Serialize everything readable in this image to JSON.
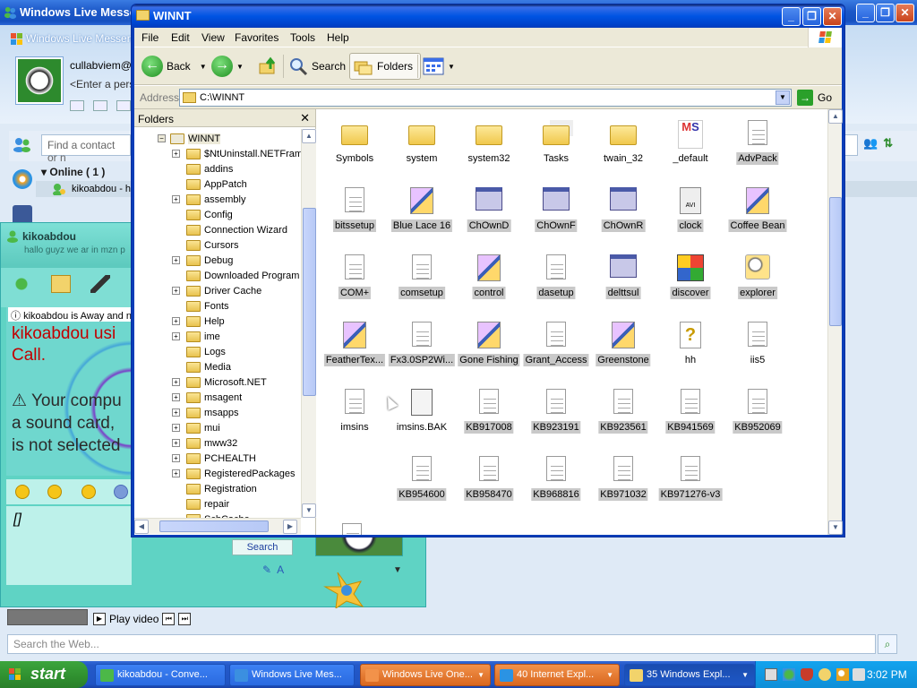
{
  "messenger": {
    "window_title": "Windows Live Messenger",
    "app_name": "Windows Live Messenger",
    "user_name": "cullabviem@",
    "personal_message": "<Enter a perso",
    "find_placeholder": "Find a contact or n",
    "group_label": "Online ( 1 )",
    "contact_name": "kikoabdou - ha",
    "play_video": "Play video",
    "web_search_placeholder": "Search the Web..."
  },
  "conversation": {
    "contact": "kikoabdou",
    "status_msg": "hallo guyz we ar in mzn p",
    "away_line": "kikoabdou is Away and n",
    "call_text_1": "kikoabdou usi",
    "call_text_2": "Call.",
    "sound_text_1": "Your compu",
    "sound_text_2": "a sound card,",
    "sound_text_3": "is not selected",
    "input_text": "[]",
    "search_label": "Search"
  },
  "explorer": {
    "title": "WINNT",
    "menu": [
      "File",
      "Edit",
      "View",
      "Favorites",
      "Tools",
      "Help"
    ],
    "toolbar": {
      "back": "Back",
      "search": "Search",
      "folders": "Folders"
    },
    "address_label": "Address",
    "address_value": "C:\\WINNT",
    "go_label": "Go",
    "folders_header": "Folders",
    "tree": [
      {
        "label": "WINNT",
        "expander": "−",
        "level": 0
      },
      {
        "label": "$NtUninstall.NETFram",
        "expander": "+",
        "level": 1
      },
      {
        "label": "addins",
        "expander": "",
        "level": 1
      },
      {
        "label": "AppPatch",
        "expander": "",
        "level": 1
      },
      {
        "label": "assembly",
        "expander": "+",
        "level": 1
      },
      {
        "label": "Config",
        "expander": "",
        "level": 1
      },
      {
        "label": "Connection Wizard",
        "expander": "",
        "level": 1
      },
      {
        "label": "Cursors",
        "expander": "",
        "level": 1
      },
      {
        "label": "Debug",
        "expander": "+",
        "level": 1
      },
      {
        "label": "Downloaded Program",
        "expander": "",
        "level": 1
      },
      {
        "label": "Driver Cache",
        "expander": "+",
        "level": 1
      },
      {
        "label": "Fonts",
        "expander": "",
        "level": 1
      },
      {
        "label": "Help",
        "expander": "+",
        "level": 1
      },
      {
        "label": "ime",
        "expander": "+",
        "level": 1
      },
      {
        "label": "Logs",
        "expander": "",
        "level": 1
      },
      {
        "label": "Media",
        "expander": "",
        "level": 1
      },
      {
        "label": "Microsoft.NET",
        "expander": "+",
        "level": 1
      },
      {
        "label": "msagent",
        "expander": "+",
        "level": 1
      },
      {
        "label": "msapps",
        "expander": "+",
        "level": 1
      },
      {
        "label": "mui",
        "expander": "+",
        "level": 1
      },
      {
        "label": "mww32",
        "expander": "+",
        "level": 1
      },
      {
        "label": "PCHEALTH",
        "expander": "+",
        "level": 1
      },
      {
        "label": "RegisteredPackages",
        "expander": "+",
        "level": 1
      },
      {
        "label": "Registration",
        "expander": "",
        "level": 1
      },
      {
        "label": "repair",
        "expander": "",
        "level": 1
      },
      {
        "label": "SchCache",
        "expander": "",
        "level": 1
      }
    ],
    "items": [
      {
        "label": "Symbols",
        "icon": "folder-icon",
        "kind": "folder",
        "selected": false
      },
      {
        "label": "system",
        "icon": "folder-icon",
        "kind": "folder",
        "selected": false
      },
      {
        "label": "system32",
        "icon": "folder-icon",
        "kind": "folder",
        "selected": false
      },
      {
        "label": "Tasks",
        "icon": "tasks-folder-icon",
        "kind": "tasks",
        "selected": false
      },
      {
        "label": "twain_32",
        "icon": "folder-icon",
        "kind": "folder",
        "selected": false
      },
      {
        "label": "_default",
        "icon": "ms-doc-icon",
        "kind": "ms",
        "selected": false
      },
      {
        "label": "AdvPack",
        "icon": "dll-icon",
        "kind": "doc",
        "selected": true
      },
      {
        "label": "bitssetup",
        "icon": "dll-icon",
        "kind": "doc",
        "selected": true
      },
      {
        "label": "Blue Lace 16",
        "icon": "bitmap-icon",
        "kind": "brush",
        "selected": true
      },
      {
        "label": "ChOwnD",
        "icon": "application-icon",
        "kind": "app",
        "selected": true
      },
      {
        "label": "ChOwnF",
        "icon": "application-icon",
        "kind": "app",
        "selected": true
      },
      {
        "label": "ChOwnR",
        "icon": "application-icon",
        "kind": "app",
        "selected": true
      },
      {
        "label": "clock",
        "icon": "avi-icon",
        "kind": "avi",
        "selected": true
      },
      {
        "label": "Coffee Bean",
        "icon": "bitmap-icon",
        "kind": "brush",
        "selected": true
      },
      {
        "label": "COM+",
        "icon": "dll-icon",
        "kind": "doc",
        "selected": true
      },
      {
        "label": "comsetup",
        "icon": "dll-icon",
        "kind": "doc",
        "selected": true
      },
      {
        "label": "control",
        "icon": "control-panel-icon",
        "kind": "brush",
        "selected": true
      },
      {
        "label": "dasetup",
        "icon": "dll-icon",
        "kind": "doc",
        "selected": true
      },
      {
        "label": "delttsul",
        "icon": "application-icon",
        "kind": "app",
        "selected": true
      },
      {
        "label": "discover",
        "icon": "discover-icon",
        "kind": "discover",
        "selected": true
      },
      {
        "label": "explorer",
        "icon": "explorer-icon",
        "kind": "search",
        "selected": true
      },
      {
        "label": "FeatherTex...",
        "icon": "bitmap-icon",
        "kind": "brush",
        "selected": true
      },
      {
        "label": "Fx3.0SP2Wi...",
        "icon": "dll-icon",
        "kind": "doc",
        "selected": true
      },
      {
        "label": "Gone Fishing",
        "icon": "bitmap-icon",
        "kind": "brush",
        "selected": true
      },
      {
        "label": "Grant_Access",
        "icon": "dll-icon",
        "kind": "doc",
        "selected": true
      },
      {
        "label": "Greenstone",
        "icon": "bitmap-icon",
        "kind": "brush",
        "selected": true
      },
      {
        "label": "hh",
        "icon": "help-icon",
        "kind": "help",
        "selected": false
      },
      {
        "label": "iis5",
        "icon": "dll-icon",
        "kind": "doc",
        "selected": false
      },
      {
        "label": "imsins",
        "icon": "dll-icon",
        "kind": "doc",
        "selected": false
      },
      {
        "label": "imsins.BAK",
        "icon": "bak-file-icon",
        "kind": "bak",
        "selected": false
      },
      {
        "label": "KB917008",
        "icon": "dll-icon",
        "kind": "doc",
        "selected": true
      },
      {
        "label": "KB923191",
        "icon": "dll-icon",
        "kind": "doc",
        "selected": true
      },
      {
        "label": "KB923561",
        "icon": "dll-icon",
        "kind": "doc",
        "selected": true
      },
      {
        "label": "KB941569",
        "icon": "dll-icon",
        "kind": "doc",
        "selected": true
      },
      {
        "label": "KB952069",
        "icon": "dll-icon",
        "kind": "doc",
        "selected": true
      },
      {
        "label": "",
        "icon": "blank",
        "kind": "none",
        "selected": false
      },
      {
        "label": "KB954600",
        "icon": "dll-icon",
        "kind": "doc",
        "selected": true
      },
      {
        "label": "KB958470",
        "icon": "dll-icon",
        "kind": "doc",
        "selected": true
      },
      {
        "label": "KB968816",
        "icon": "dll-icon",
        "kind": "doc",
        "selected": true
      },
      {
        "label": "KB971032",
        "icon": "dll-icon",
        "kind": "doc",
        "selected": true
      },
      {
        "label": "KB971276-v3",
        "icon": "dll-icon",
        "kind": "doc",
        "selected": true
      }
    ]
  },
  "taskbar": {
    "start_label": "start",
    "buttons": [
      {
        "label": "kikoabdou - Conve...",
        "style": "blue"
      },
      {
        "label": "Windows Live Mes...",
        "style": "blue"
      },
      {
        "label": "Windows Live One...",
        "style": "orange"
      },
      {
        "label": "40 Internet Expl...",
        "style": "orange"
      },
      {
        "label": "35 Windows Expl...",
        "style": "active"
      }
    ],
    "clock": "3:02 PM"
  },
  "colors": {
    "xp_blue": "#0054e3",
    "start_green": "#2f8f2f",
    "convo_teal": "#5fd3c4",
    "selection_grey": "#c9c9c9"
  }
}
